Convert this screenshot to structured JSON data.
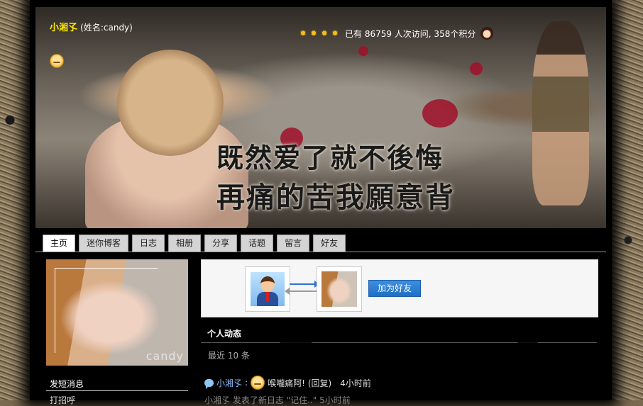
{
  "owner": {
    "nickname": "小湘孓",
    "realname": "(姓名:candy)"
  },
  "stats": {
    "text": "已有 86759 人次访问, 358个积分"
  },
  "banner": {
    "line1": "既然爱了就不後悔",
    "line2": "再痛的苦我願意背"
  },
  "nav": {
    "tabs": [
      "主页",
      "迷你博客",
      "日志",
      "相册",
      "分享",
      "话题",
      "留言",
      "好友"
    ],
    "active": "主页"
  },
  "photo": {
    "watermark": "candy"
  },
  "sidebar": {
    "send_message": "发短消息",
    "next_item": "打招呼"
  },
  "friend": {
    "add_button": "加为好友"
  },
  "activity": {
    "title": "个人动态",
    "recent": "最近 10 条",
    "items": [
      {
        "who": "小湘孓",
        "sep": ":",
        "text": "喉嚨痛阿!",
        "reply": "(回复)",
        "time": "4小时前"
      },
      {
        "text": "小湘孓 发表了新日志 \"记住..\" 5小时前"
      }
    ]
  },
  "colors": {
    "nickname": "#ffea00",
    "tab_active": "#ffffff",
    "button": "#1f6fc4"
  }
}
